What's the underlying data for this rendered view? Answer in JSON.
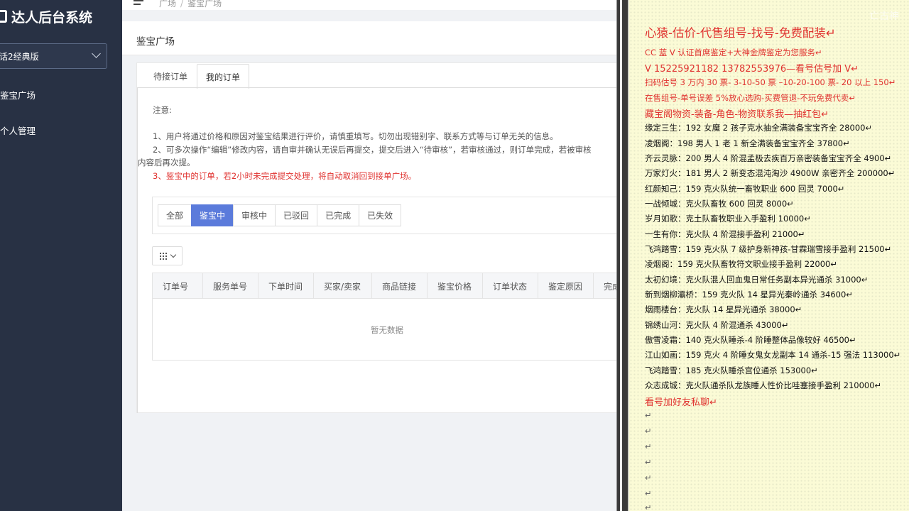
{
  "sidebar": {
    "title": "达人后台系统",
    "version_label": "话2经典版",
    "items": [
      {
        "label": "鉴宝广场"
      },
      {
        "label": "个人管理"
      }
    ]
  },
  "breadcrumb": {
    "items": [
      "广场",
      "鉴宝广场"
    ],
    "separator": "/"
  },
  "page": {
    "title": "鉴宝广场",
    "tabs": [
      {
        "label": "待接订单",
        "active": false
      },
      {
        "label": "我的订单",
        "active": true
      }
    ],
    "notice": {
      "title": "注意:",
      "lines": [
        {
          "text": "1、用户将通过价格和原因对鉴宝结果进行评价，请慎重填写。切勿出现错别字、联系方式等与订单无关的信息。",
          "red": false
        },
        {
          "text": "2、可多次操作“编辑”修改内容，请自审并确认无误后再提交，提交后进入“待审核”，若审核通过，则订单完成，若被审核",
          "red": false
        },
        {
          "text": "内容后再次提。",
          "red": false
        },
        {
          "text": "3、鉴宝中的订单，若2小时未完成提交处理，将自动取消回到接单广场。",
          "red": true
        }
      ]
    },
    "filters": [
      {
        "label": "全部",
        "active": false
      },
      {
        "label": "鉴宝中",
        "active": true
      },
      {
        "label": "审核中",
        "active": false
      },
      {
        "label": "已驳回",
        "active": false
      },
      {
        "label": "已完成",
        "active": false
      },
      {
        "label": "已失效",
        "active": false
      }
    ],
    "table": {
      "columns": [
        "订单号",
        "服务单号",
        "下单时间",
        "买家/卖家",
        "商品链接",
        "鉴宝价格",
        "订单状态",
        "鉴定原因",
        "完成"
      ],
      "empty_text": "暂无数据"
    }
  },
  "notes": {
    "watermark": "亡古神",
    "lines": [
      {
        "text": "心猿-估价-代售组号-找号-免费配装↵",
        "style": "red big"
      },
      {
        "text": "CC 蓝 V 认证首席鉴定+大神金牌鉴定为您服务↵",
        "style": "red"
      },
      {
        "text": "V 15225921182     13782553976—看号估号加 V↵",
        "style": "red mid"
      },
      {
        "text": "扫码估号 3 万内 30 票- 3-10-50 票  –10-20-100 票- 20 以上 150↵",
        "style": "red"
      },
      {
        "text": "在售组号-单号误差 5%放心选购-买费管退-不玩免费代卖↵",
        "style": "red"
      },
      {
        "text": "藏宝阁物资-装备-角色-物资联系我—抽红包↵",
        "style": "red mid"
      },
      {
        "text": "缘定三生：192 女魔 2 孩子克水抽全满装备宝宝齐全 28000↵",
        "style": ""
      },
      {
        "text": "凌烟阁：198 男人 1 老 1 新全满装备宝宝齐全 37800↵",
        "style": ""
      },
      {
        "text": "齐云灵脉：200 男人 4 阶混孟极去疾百万亲密装备宝宝齐全 4900↵",
        "style": ""
      },
      {
        "text": "万家灯火：181 男人 2 新变态混沌淘沙 4900W 亲密齐全 200000↵",
        "style": ""
      },
      {
        "text": "红颜知己：159 克火队统一畜牧职业 600 回灵 7000↵",
        "style": ""
      },
      {
        "text": "一战倾城：克火队畜牧 600 回灵 8000↵",
        "style": ""
      },
      {
        "text": "岁月如歌：克土队畜牧职业入手盈利 10000↵",
        "style": ""
      },
      {
        "text": "一生有你：克火队 4 阶混接手盈利 21000↵",
        "style": ""
      },
      {
        "text": "飞鸿踏雪：159 克火队 7 级护身新神孩-甘霖瑞雪接手盈利 21500↵",
        "style": ""
      },
      {
        "text": "凌烟阁：159 克火队畜牧符文职业接手盈利 22000↵",
        "style": ""
      },
      {
        "text": "太初幻境：克火队混人回血鬼日常任务副本异光通杀 31000↵",
        "style": ""
      },
      {
        "text": "新到烟柳灞桥：159 克火队 14 星异光秦岭通杀 34600↵",
        "style": ""
      },
      {
        "text": "烟雨楼台：克火队 14 星异光通杀 38000↵",
        "style": ""
      },
      {
        "text": "锦绣山河：克火队 4 阶混通杀 43000↵",
        "style": ""
      },
      {
        "text": "傲雪凌霜：140 克火队睡杀-4 阶睡整体品像较好 46500↵",
        "style": ""
      },
      {
        "text": "江山如画：159 克火 4 阶睡女鬼女龙副本 14 通杀-15 强法 113000↵",
        "style": ""
      },
      {
        "text": "飞鸿踏雪：185 克火队睡杀宫位通杀 153000↵",
        "style": ""
      },
      {
        "text": "众志成城：克火队通杀队龙族睡人性价比哇塞接手盈利 210000↵",
        "style": ""
      },
      {
        "text": "看号加好友私聊↵",
        "style": "red mid"
      },
      {
        "text": "↵",
        "style": "ret"
      },
      {
        "text": "↵",
        "style": "ret"
      },
      {
        "text": "↵",
        "style": "ret"
      },
      {
        "text": "↵",
        "style": "ret"
      },
      {
        "text": "↵",
        "style": "ret"
      },
      {
        "text": "↵",
        "style": "ret"
      },
      {
        "text": "↵",
        "style": "ret"
      }
    ]
  }
}
